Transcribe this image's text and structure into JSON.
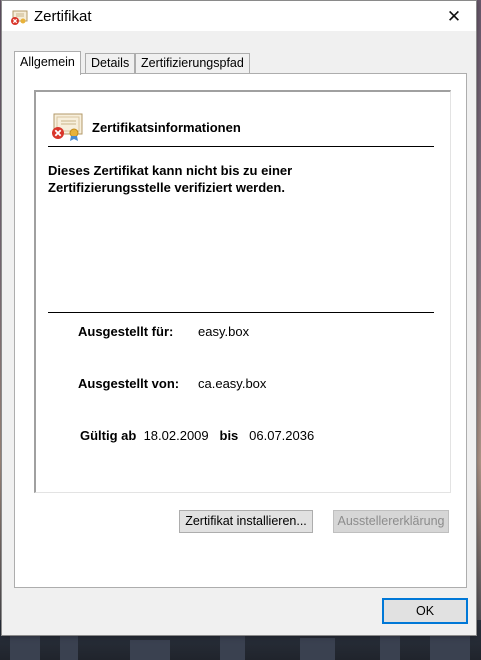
{
  "window": {
    "title": "Zertifikat",
    "close_glyph": "✕"
  },
  "tabs": [
    {
      "label": "Allgemein",
      "active": true
    },
    {
      "label": "Details",
      "active": false
    },
    {
      "label": "Zertifizierungspfad",
      "active": false
    }
  ],
  "general": {
    "info_title": "Zertifikatsinformationen",
    "warning_line1": "Dieses Zertifikat kann nicht bis zu einer",
    "warning_line2": "Zertifizierungsstelle verifiziert werden.",
    "issued_to_label": "Ausgestellt für:",
    "issued_to_value": "easy.box",
    "issued_by_label": "Ausgestellt von:",
    "issued_by_value": "ca.easy.box",
    "valid_from_label": "Gültig ab",
    "valid_from_value": "18.02.2009",
    "valid_to_label": "bis",
    "valid_to_value": "06.07.2036"
  },
  "buttons": {
    "install": "Zertifikat installieren...",
    "issuer_statement": "Ausstellererklärung",
    "ok": "OK"
  },
  "icons": {
    "title": "certificate-error-icon",
    "info": "certificate-error-icon",
    "close": "close-icon"
  },
  "colors": {
    "accent": "#0078d7",
    "error_red": "#d9362b"
  }
}
